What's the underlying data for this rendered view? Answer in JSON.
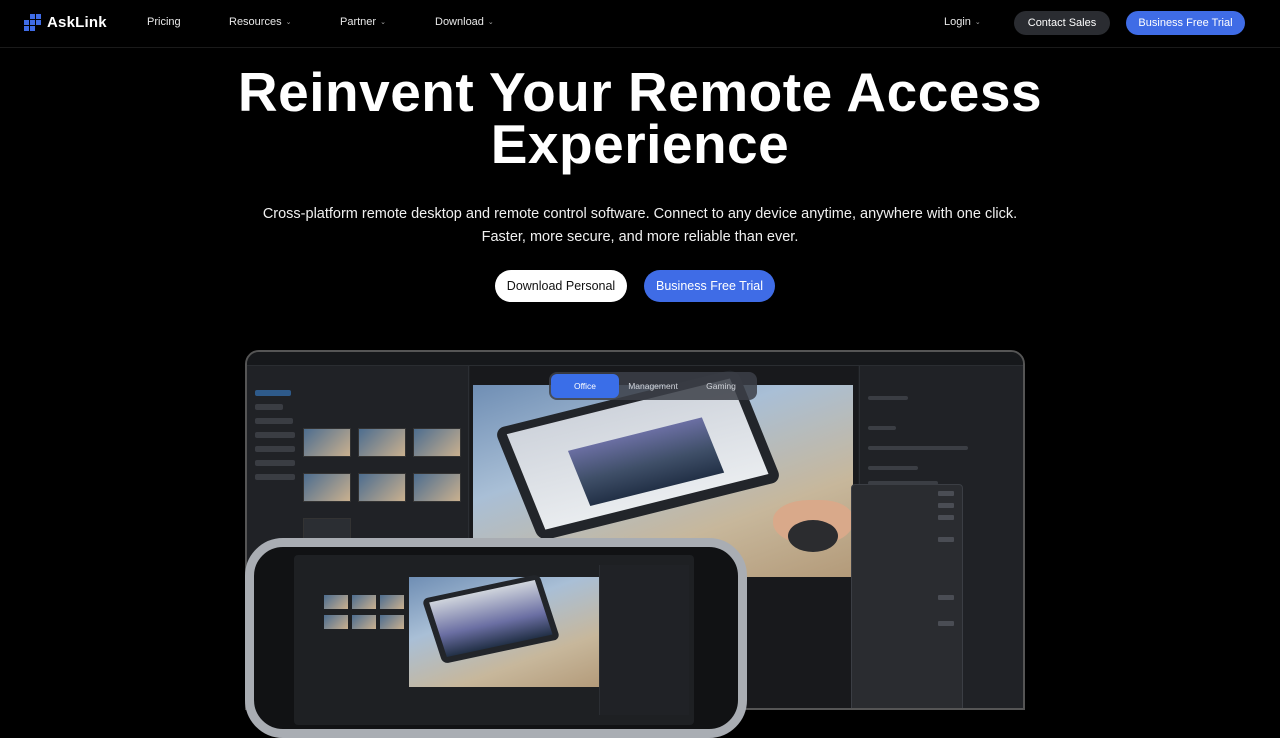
{
  "brand": {
    "name": "AskLink",
    "accent": "#3f6ce6"
  },
  "nav": {
    "items": [
      {
        "label": "Pricing",
        "dropdown": false
      },
      {
        "label": "Resources",
        "dropdown": true
      },
      {
        "label": "Partner",
        "dropdown": true
      },
      {
        "label": "Download",
        "dropdown": true
      }
    ],
    "login": "Login",
    "contact_sales": "Contact Sales",
    "trial": "Business Free Trial"
  },
  "hero": {
    "title_line1": "Reinvent Your Remote Access",
    "title_line2": "Experience",
    "subtitle_line1": "Cross-platform remote desktop and remote control software. Connect to any device anytime, anywhere with one click.",
    "subtitle_line2": "Faster, more secure, and more reliable than ever.",
    "download_personal": "Download Personal",
    "business_trial": "Business Free Trial"
  },
  "showcase": {
    "tabs": [
      "Office",
      "Management",
      "Gaming"
    ],
    "active_tab": "Office"
  },
  "icons": {
    "chevron": "chevron-down-icon",
    "logo": "asklink-logo-icon"
  }
}
